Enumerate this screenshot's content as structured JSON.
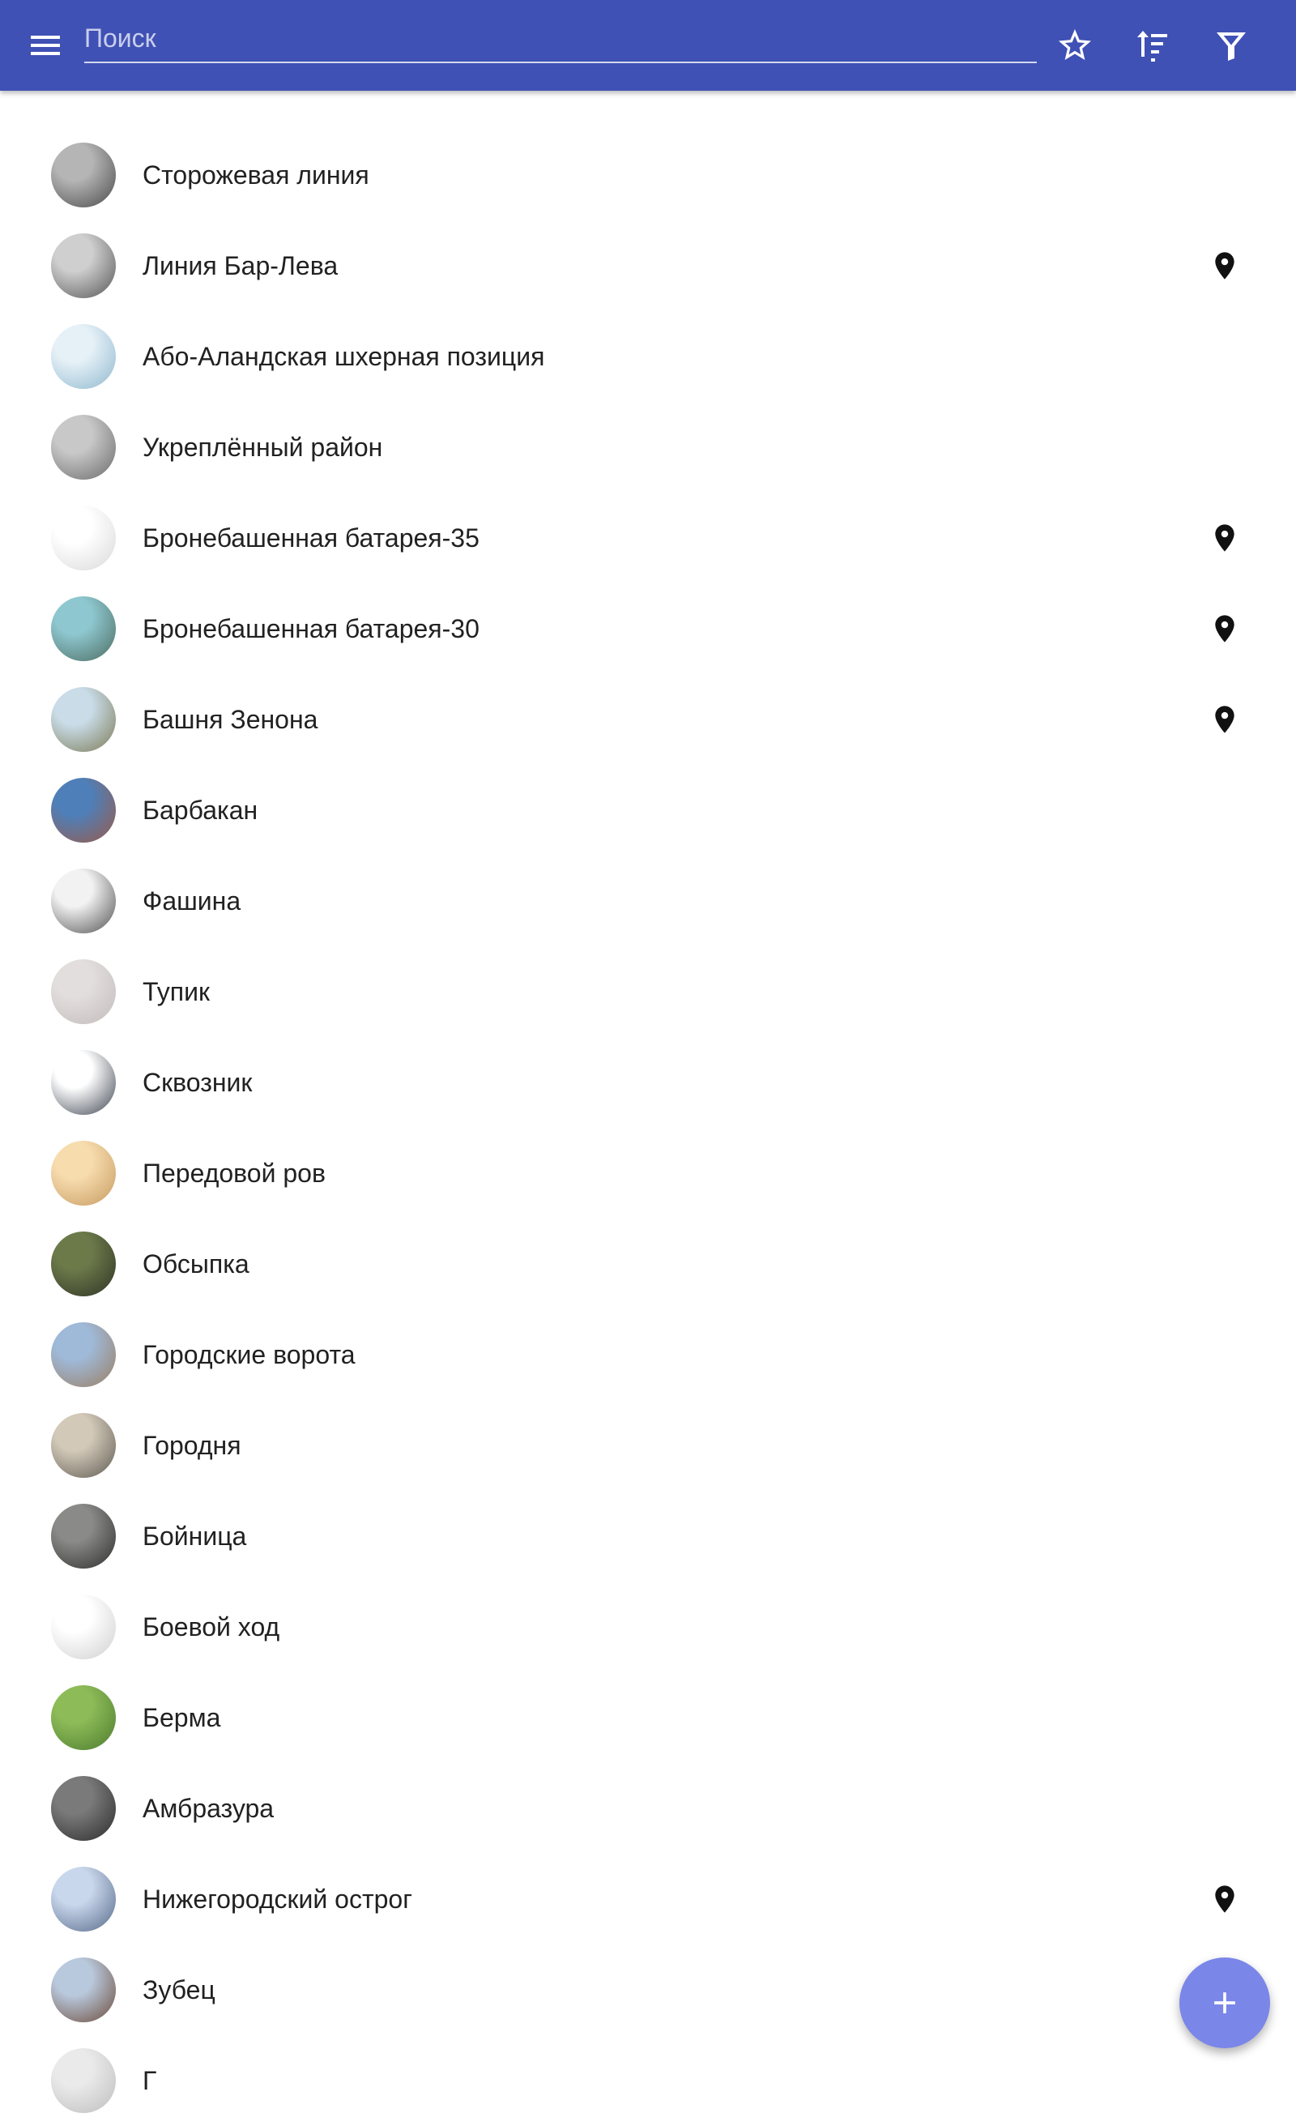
{
  "toolbar": {
    "color": "#3f51b5",
    "search": {
      "placeholder": "Поиск",
      "value": ""
    },
    "menu_icon": "menu-icon",
    "actions": [
      "star-outline-icon",
      "sort-icon",
      "filter-icon"
    ]
  },
  "items": [
    {
      "label": "Сторожевая линия",
      "has_location": false,
      "thumb": [
        "#b5b5b5",
        "#4a4a4a"
      ]
    },
    {
      "label": "Линия Бар-Лева",
      "has_location": true,
      "thumb": [
        "#cfcfcf",
        "#555555"
      ]
    },
    {
      "label": "Або-Аландская шхерная позиция",
      "has_location": false,
      "thumb": [
        "#e6f1f7",
        "#8fb8cf"
      ]
    },
    {
      "label": "Укреплённый район",
      "has_location": false,
      "thumb": [
        "#c8c8c8",
        "#6a6a6a"
      ]
    },
    {
      "label": "Бронебашенная батарея-35",
      "has_location": true,
      "thumb": [
        "#ffffff",
        "#d9d9d9"
      ]
    },
    {
      "label": "Бронебашенная батарея-30",
      "has_location": true,
      "thumb": [
        "#8ec7cf",
        "#4b6b60"
      ]
    },
    {
      "label": "Башня Зенона",
      "has_location": true,
      "thumb": [
        "#c9dce8",
        "#7c7a55"
      ]
    },
    {
      "label": "Барбакан",
      "has_location": false,
      "thumb": [
        "#4f7fb8",
        "#9a5a48"
      ]
    },
    {
      "label": "Фашина",
      "has_location": false,
      "thumb": [
        "#f2f2f2",
        "#505050"
      ]
    },
    {
      "label": "Тупик",
      "has_location": false,
      "thumb": [
        "#e2dedd",
        "#c2bcbb"
      ]
    },
    {
      "label": "Сквозник",
      "has_location": false,
      "thumb": [
        "#ffffff",
        "#3d4450"
      ]
    },
    {
      "label": "Передовой ров",
      "has_location": false,
      "thumb": [
        "#f7dcae",
        "#c69a60"
      ]
    },
    {
      "label": "Обсыпка",
      "has_location": false,
      "thumb": [
        "#6c7a4a",
        "#2f3325"
      ]
    },
    {
      "label": "Городские ворота",
      "has_location": false,
      "thumb": [
        "#9fb9d8",
        "#9a7e62"
      ]
    },
    {
      "label": "Городня",
      "has_location": false,
      "thumb": [
        "#d2c9b8",
        "#5f5a52"
      ]
    },
    {
      "label": "Бойница",
      "has_location": false,
      "thumb": [
        "#8a8a88",
        "#2e2e2e"
      ]
    },
    {
      "label": "Боевой ход",
      "has_location": false,
      "thumb": [
        "#ffffff",
        "#cfcfcf"
      ]
    },
    {
      "label": "Берма",
      "has_location": false,
      "thumb": [
        "#8dbb58",
        "#4c7b2e"
      ]
    },
    {
      "label": "Амбразура",
      "has_location": false,
      "thumb": [
        "#7a7a7a",
        "#2b2b2b"
      ]
    },
    {
      "label": "Нижегородский острог",
      "has_location": true,
      "thumb": [
        "#c9d7ec",
        "#566988"
      ]
    },
    {
      "label": "Зубец",
      "has_location": false,
      "thumb": [
        "#b9c9dd",
        "#6b4a38"
      ]
    },
    {
      "label": "Г",
      "has_location": false,
      "thumb": [
        "#eaeaea",
        "#bdbdbd"
      ]
    }
  ],
  "fab": {
    "icon": "plus-icon",
    "color": "#7a86e8"
  }
}
